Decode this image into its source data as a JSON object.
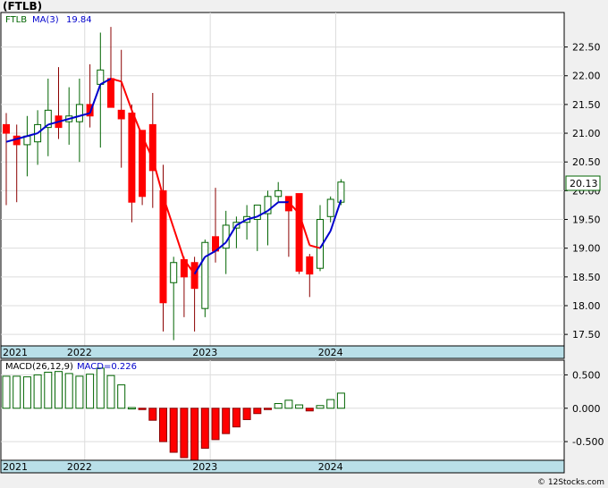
{
  "ticker_title": "(FTLB)",
  "credit": "© 12Stocks.com",
  "chart_data": [
    {
      "type": "candlestick",
      "interval": "monthly",
      "legend": {
        "symbol": "FTLB",
        "ma_label": "MA(3)",
        "ma_value": "19.84"
      },
      "last_price": "20.13",
      "ylim": [
        17.3,
        23.1
      ],
      "y_ticks": [
        "22.50",
        "22.00",
        "21.50",
        "21.00",
        "20.50",
        "20.00",
        "19.50",
        "19.00",
        "18.50",
        "18.00",
        "17.50"
      ],
      "x_ticks": [
        {
          "label": "2021",
          "index": -1
        },
        {
          "label": "2022",
          "index": 7
        },
        {
          "label": "2023",
          "index": 19
        },
        {
          "label": "2024",
          "index": 31
        }
      ],
      "candles": [
        {
          "o": 21.15,
          "h": 21.35,
          "l": 19.75,
          "c": 21.0
        },
        {
          "o": 20.95,
          "h": 21.15,
          "l": 19.8,
          "c": 20.8
        },
        {
          "o": 20.8,
          "h": 21.3,
          "l": 20.25,
          "c": 20.95
        },
        {
          "o": 20.85,
          "h": 21.4,
          "l": 20.45,
          "c": 21.15
        },
        {
          "o": 21.1,
          "h": 21.95,
          "l": 20.6,
          "c": 21.4
        },
        {
          "o": 21.3,
          "h": 22.15,
          "l": 20.9,
          "c": 21.1
        },
        {
          "o": 21.2,
          "h": 21.8,
          "l": 20.8,
          "c": 21.3
        },
        {
          "o": 21.2,
          "h": 21.95,
          "l": 20.5,
          "c": 21.5
        },
        {
          "o": 21.5,
          "h": 22.2,
          "l": 21.1,
          "c": 21.3
        },
        {
          "o": 21.85,
          "h": 22.75,
          "l": 20.75,
          "c": 22.1
        },
        {
          "o": 21.95,
          "h": 22.85,
          "l": 21.5,
          "c": 21.45
        },
        {
          "o": 21.4,
          "h": 22.45,
          "l": 20.4,
          "c": 21.25
        },
        {
          "o": 21.35,
          "h": 21.5,
          "l": 19.45,
          "c": 19.8
        },
        {
          "o": 21.05,
          "h": 21.05,
          "l": 19.75,
          "c": 19.9
        },
        {
          "o": 21.15,
          "h": 21.7,
          "l": 19.7,
          "c": 20.35
        },
        {
          "o": 20.0,
          "h": 20.45,
          "l": 17.55,
          "c": 18.05
        },
        {
          "o": 18.4,
          "h": 18.85,
          "l": 17.4,
          "c": 18.75
        },
        {
          "o": 18.8,
          "h": 18.85,
          "l": 17.8,
          "c": 18.5
        },
        {
          "o": 18.75,
          "h": 18.85,
          "l": 17.55,
          "c": 18.3
        },
        {
          "o": 17.95,
          "h": 19.15,
          "l": 17.8,
          "c": 19.1
        },
        {
          "o": 19.2,
          "h": 20.05,
          "l": 18.75,
          "c": 18.95
        },
        {
          "o": 19.0,
          "h": 19.65,
          "l": 18.55,
          "c": 19.4
        },
        {
          "o": 19.35,
          "h": 19.55,
          "l": 19.0,
          "c": 19.45
        },
        {
          "o": 19.45,
          "h": 19.75,
          "l": 19.15,
          "c": 19.55
        },
        {
          "o": 19.5,
          "h": 19.65,
          "l": 18.95,
          "c": 19.75
        },
        {
          "o": 19.6,
          "h": 20.0,
          "l": 19.05,
          "c": 19.9
        },
        {
          "o": 19.9,
          "h": 20.15,
          "l": 19.8,
          "c": 20.0
        },
        {
          "o": 19.9,
          "h": 19.9,
          "l": 18.85,
          "c": 19.65
        },
        {
          "o": 19.95,
          "h": 19.95,
          "l": 18.55,
          "c": 18.6
        },
        {
          "o": 18.85,
          "h": 18.9,
          "l": 18.15,
          "c": 18.55
        },
        {
          "o": 18.65,
          "h": 19.75,
          "l": 18.6,
          "c": 19.5
        },
        {
          "o": 19.55,
          "h": 19.9,
          "l": 19.45,
          "c": 19.85
        },
        {
          "o": 19.8,
          "h": 20.2,
          "l": 19.75,
          "c": 20.15
        }
      ],
      "ma3": [
        20.85,
        20.9,
        20.95,
        21.0,
        21.15,
        21.2,
        21.25,
        21.3,
        21.35,
        21.85,
        21.95,
        21.9,
        21.4,
        20.95,
        20.55,
        19.9,
        19.35,
        18.8,
        18.55,
        18.85,
        18.95,
        19.1,
        19.4,
        19.5,
        19.55,
        19.65,
        19.8,
        19.8,
        19.6,
        19.05,
        19.0,
        19.3,
        19.84
      ]
    },
    {
      "type": "bar",
      "legend": {
        "label": "MACD(26,12,9)",
        "value_label": "MACD=0.226"
      },
      "ylim": [
        -0.78,
        0.72
      ],
      "y_ticks": [
        "0.500",
        "0.000",
        "-0.500"
      ],
      "x_ticks": [
        {
          "label": "2021",
          "index": -1
        },
        {
          "label": "2022",
          "index": 7
        },
        {
          "label": "2023",
          "index": 19
        },
        {
          "label": "2024",
          "index": 31
        }
      ],
      "values": [
        0.48,
        0.48,
        0.47,
        0.5,
        0.54,
        0.55,
        0.52,
        0.48,
        0.51,
        0.6,
        0.49,
        0.35,
        0.01,
        -0.01,
        -0.18,
        -0.5,
        -0.66,
        -0.74,
        -0.78,
        -0.6,
        -0.47,
        -0.38,
        -0.28,
        -0.17,
        -0.08,
        -0.02,
        0.07,
        0.12,
        0.05,
        -0.04,
        0.04,
        0.13,
        0.226
      ]
    }
  ]
}
